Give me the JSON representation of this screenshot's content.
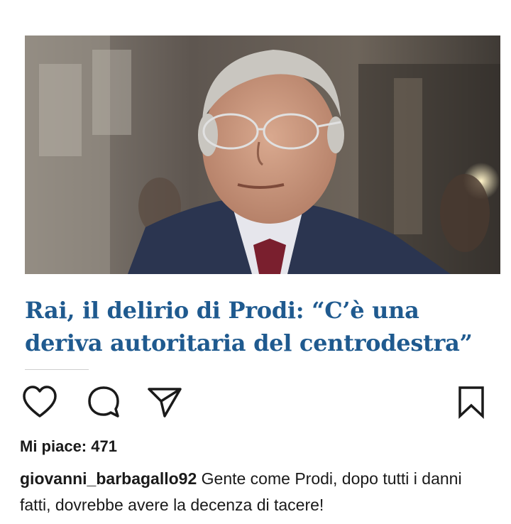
{
  "post": {
    "photo_description": "portrait",
    "headline": "Rai, il delirio di Prodi: “C’è una deriva autoritaria del centrodestra”",
    "headline_color": "#1f5a8f"
  },
  "actions": {
    "like_icon": "heart-icon",
    "comment_icon": "comment-bubble-icon",
    "share_icon": "paper-plane-icon",
    "save_icon": "bookmark-icon"
  },
  "likes": {
    "label": "Mi piace: 471"
  },
  "caption": {
    "username": "giovanni_barbagallo92",
    "text": "Gente come Prodi, dopo tutti i danni fatti, dovrebbe avere la decenza di tacere!"
  }
}
